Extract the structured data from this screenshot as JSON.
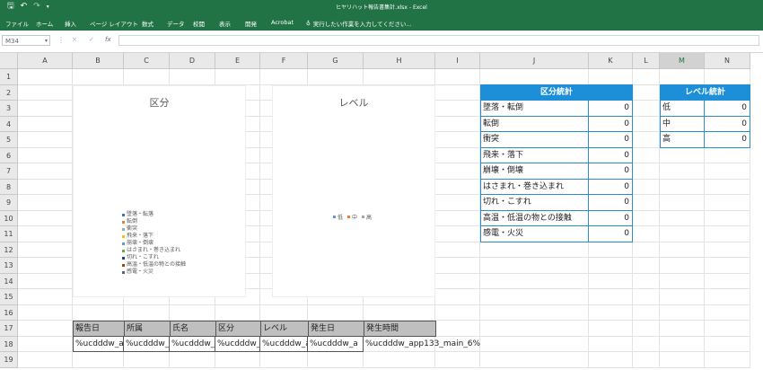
{
  "window": {
    "title": "ヒヤリハット報告書集計.xlsx - Excel"
  },
  "ribbon": {
    "tabs": [
      "ファイル",
      "ホーム",
      "挿入",
      "ページ レイアウト",
      "数式",
      "データ",
      "校閲",
      "表示",
      "開発",
      "Acrobat"
    ],
    "tell_me": "実行したい作業を入力してください..."
  },
  "formula_bar": {
    "name_box": "M34",
    "cancel": "×",
    "enter": "✓",
    "fx": "fx"
  },
  "columns": [
    "A",
    "B",
    "C",
    "D",
    "E",
    "F",
    "G",
    "H",
    "I",
    "J",
    "K",
    "L",
    "M",
    "N"
  ],
  "selected_column": "M",
  "rows": [
    "1",
    "2",
    "3",
    "4",
    "5",
    "6",
    "7",
    "8",
    "9",
    "10",
    "11",
    "12",
    "13",
    "14",
    "15",
    "16",
    "17",
    "18",
    "19"
  ],
  "charts": {
    "category_chart": {
      "title": "区分",
      "legend": [
        "墜落・転落",
        "転倒",
        "衝突",
        "飛来・落下",
        "崩壊・倒壊",
        "はさまれ・巻き込まれ",
        "切れ・こすれ",
        "高温・低温の物との接触",
        "感電・火災"
      ],
      "colors": [
        "#4472c4",
        "#ed7d31",
        "#a5a5a5",
        "#ffc000",
        "#5b9bd5",
        "#70ad47",
        "#264478",
        "#9e480e",
        "#636363"
      ]
    },
    "level_chart": {
      "title": "レベル",
      "legend": [
        "低",
        "中",
        "高"
      ],
      "colors": [
        "#5b9bd5",
        "#ed7d31",
        "#a5a5a5"
      ]
    }
  },
  "category_stats": {
    "header": "区分統計",
    "rows": [
      {
        "label": "墜落・転倒",
        "value": "0"
      },
      {
        "label": "転倒",
        "value": "0"
      },
      {
        "label": "衝突",
        "value": "0"
      },
      {
        "label": "飛来・落下",
        "value": "0"
      },
      {
        "label": "崩壊・倒壊",
        "value": "0"
      },
      {
        "label": "はさまれ・巻き込まれ",
        "value": "0"
      },
      {
        "label": "切れ・こすれ",
        "value": "0"
      },
      {
        "label": "高温・低温の物との接触",
        "value": "0"
      },
      {
        "label": "感電・火災",
        "value": "0"
      }
    ]
  },
  "level_stats": {
    "header": "レベル統計",
    "rows": [
      {
        "label": "低",
        "value": "0"
      },
      {
        "label": "中",
        "value": "0"
      },
      {
        "label": "高",
        "value": "0"
      }
    ]
  },
  "report_table": {
    "headers": [
      "報告日",
      "所属",
      "氏名",
      "区分",
      "レベル",
      "発生日",
      "発生時間"
    ],
    "row": [
      "%ucdddw_a",
      "%ucdddw_",
      "%ucdddw_",
      "%ucdddw_",
      "%ucdddw_a",
      "%ucdddw_a",
      "%ucdddw_app133_main_6%"
    ]
  }
}
